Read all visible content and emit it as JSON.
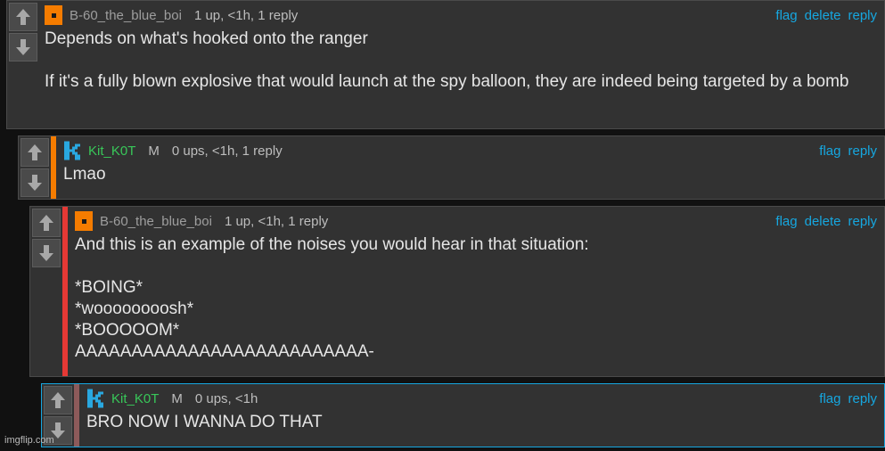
{
  "comments": [
    {
      "username": "B-60_the_blue_boi",
      "meta": "1 up, <1h, 1 reply",
      "actions": [
        "flag",
        "delete",
        "reply"
      ],
      "paragraphs": [
        "Depends on what's hooked onto the ranger",
        "If it's a fully blown explosive that would launch at the spy balloon, they are indeed being targeted by a bomb"
      ]
    },
    {
      "username": "Kit_K0T",
      "mod_badge": "M",
      "meta": "0 ups, <1h, 1 reply",
      "actions": [
        "flag",
        "reply"
      ],
      "paragraphs": [
        "Lmao"
      ]
    },
    {
      "username": "B-60_the_blue_boi",
      "meta": "1 up, <1h, 1 reply",
      "actions": [
        "flag",
        "delete",
        "reply"
      ],
      "paragraphs": [
        "And this is an example of the noises you would hear in that situation:",
        "*BOING*\n*woooooooosh*\n*BOOOOOM*\nAAAAAAAAAAAAAAAAAAAAAAAAAA-"
      ]
    },
    {
      "username": "Kit_K0T",
      "mod_badge": "M",
      "meta": "0 ups, <1h",
      "actions": [
        "flag",
        "reply"
      ],
      "paragraphs": [
        "BRO NOW I WANNA DO THAT"
      ]
    }
  ],
  "icons": {
    "upvote": "arrow-up-icon",
    "downvote": "arrow-down-icon",
    "orange_avatar": "orange-square-avatar",
    "kit_avatar": "pixel-k-avatar"
  },
  "colors": {
    "thread_orange": "#f57c00",
    "thread_red": "#e53935",
    "thread_brown": "#8d5a5a",
    "link_blue": "#16a7e0",
    "mod_green": "#38c759"
  },
  "watermark": "imgflip.com"
}
